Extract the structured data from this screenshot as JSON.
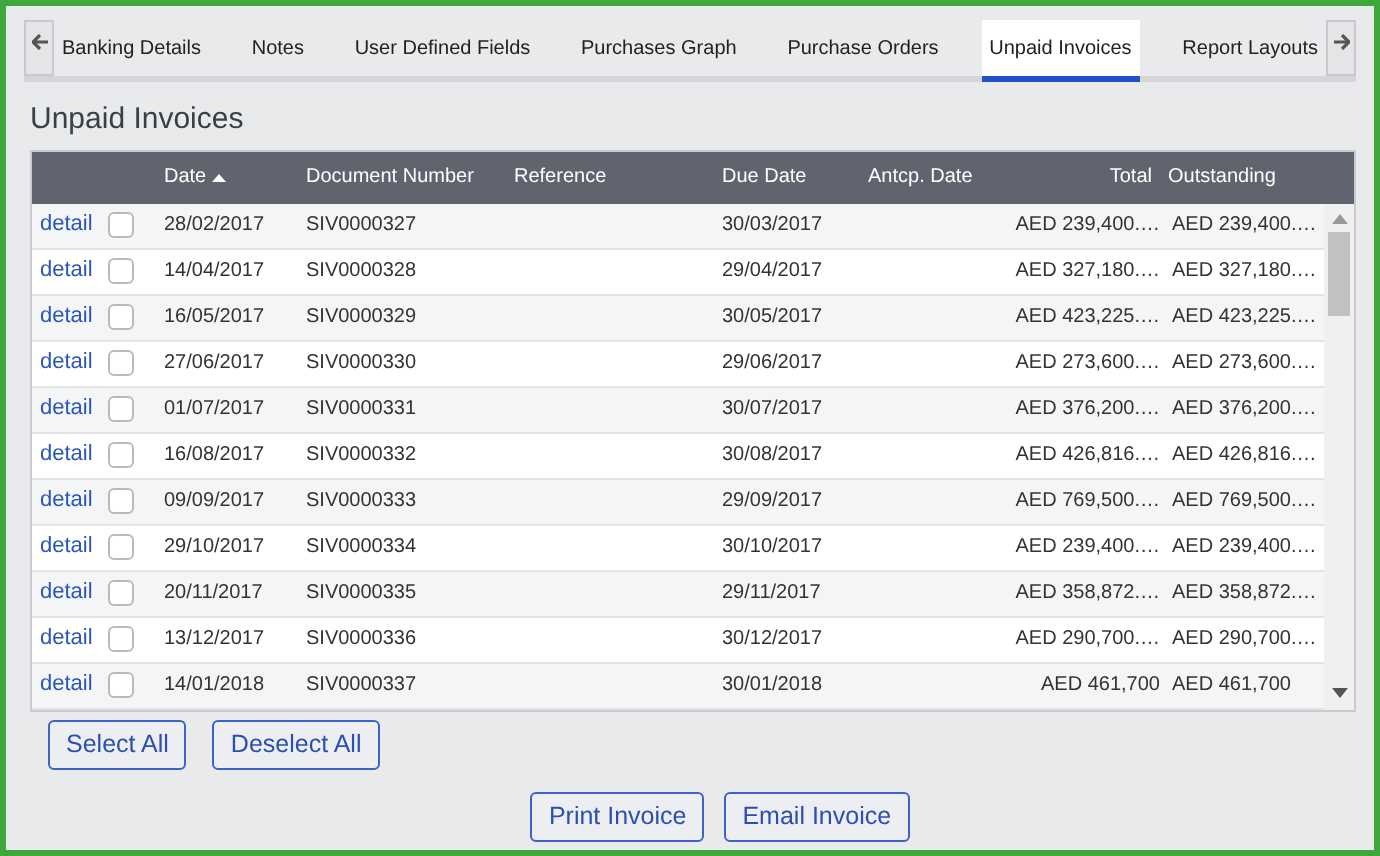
{
  "tabs": [
    {
      "label": "Banking Details",
      "selected": false
    },
    {
      "label": "Notes",
      "selected": false
    },
    {
      "label": "User Defined Fields",
      "selected": false
    },
    {
      "label": "Purchases Graph",
      "selected": false
    },
    {
      "label": "Purchase Orders",
      "selected": false
    },
    {
      "label": "Unpaid Invoices",
      "selected": true
    },
    {
      "label": "Report Layouts",
      "selected": false
    }
  ],
  "heading": "Unpaid Invoices",
  "table": {
    "columns": [
      {
        "label": "Date",
        "sorted_ascending": true
      },
      {
        "label": "Document Number",
        "sorted_ascending": false
      },
      {
        "label": "Reference",
        "sorted_ascending": false
      },
      {
        "label": "Due Date",
        "sorted_ascending": false
      },
      {
        "label": "Antcp. Date",
        "sorted_ascending": false
      },
      {
        "label": "Total",
        "sorted_ascending": false
      },
      {
        "label": "Outstanding",
        "sorted_ascending": false
      }
    ],
    "rows": [
      {
        "link": "detail",
        "checked": false,
        "date": "28/02/2017",
        "document_number": "SIV0000327",
        "due_date": "30/03/2017",
        "total": "AED 239,400.…",
        "outstanding": "AED 239,400.…"
      },
      {
        "link": "detail",
        "checked": false,
        "date": "14/04/2017",
        "document_number": "SIV0000328",
        "due_date": "29/04/2017",
        "total": "AED 327,180.…",
        "outstanding": "AED 327,180.…"
      },
      {
        "link": "detail",
        "checked": false,
        "date": "16/05/2017",
        "document_number": "SIV0000329",
        "due_date": "30/05/2017",
        "total": "AED 423,225.…",
        "outstanding": "AED 423,225.…"
      },
      {
        "link": "detail",
        "checked": false,
        "date": "27/06/2017",
        "document_number": "SIV0000330",
        "due_date": "29/06/2017",
        "total": "AED 273,600.…",
        "outstanding": "AED 273,600.…"
      },
      {
        "link": "detail",
        "checked": false,
        "date": "01/07/2017",
        "document_number": "SIV0000331",
        "due_date": "30/07/2017",
        "total": "AED 376,200.…",
        "outstanding": "AED 376,200.…"
      },
      {
        "link": "detail",
        "checked": false,
        "date": "16/08/2017",
        "document_number": "SIV0000332",
        "due_date": "30/08/2017",
        "total": "AED 426,816.…",
        "outstanding": "AED 426,816.…"
      },
      {
        "link": "detail",
        "checked": false,
        "date": "09/09/2017",
        "document_number": "SIV0000333",
        "due_date": "29/09/2017",
        "total": "AED 769,500.…",
        "outstanding": "AED 769,500.…"
      },
      {
        "link": "detail",
        "checked": false,
        "date": "29/10/2017",
        "document_number": "SIV0000334",
        "due_date": "30/10/2017",
        "total": "AED 239,400.…",
        "outstanding": "AED 239,400.…"
      },
      {
        "link": "detail",
        "checked": false,
        "date": "20/11/2017",
        "document_number": "SIV0000335",
        "due_date": "29/11/2017",
        "total": "AED 358,872.…",
        "outstanding": "AED 358,872.…"
      },
      {
        "link": "detail",
        "checked": false,
        "date": "13/12/2017",
        "document_number": "SIV0000336",
        "due_date": "30/12/2017",
        "total": "AED 290,700.…",
        "outstanding": "AED 290,700.…"
      },
      {
        "link": "detail",
        "checked": false,
        "date": "14/01/2018",
        "document_number": "SIV0000337",
        "due_date": "30/01/2018",
        "total": "AED 461,700",
        "outstanding": "AED 461,700"
      }
    ]
  },
  "selection_buttons": [
    "Select All",
    "Deselect All"
  ],
  "action_buttons": [
    "Print Invoice",
    "Email Invoice"
  ]
}
